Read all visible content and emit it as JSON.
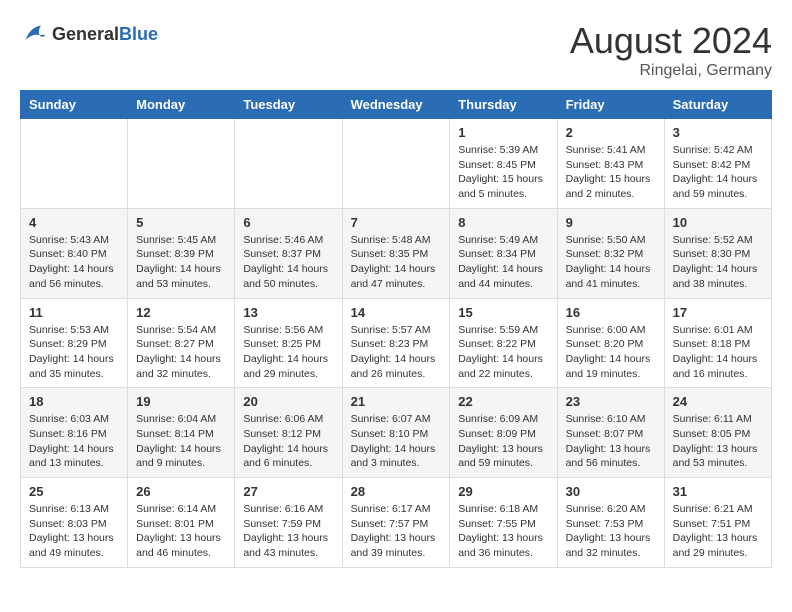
{
  "header": {
    "logo_general": "General",
    "logo_blue": "Blue",
    "month_year": "August 2024",
    "location": "Ringelai, Germany"
  },
  "days_of_week": [
    "Sunday",
    "Monday",
    "Tuesday",
    "Wednesday",
    "Thursday",
    "Friday",
    "Saturday"
  ],
  "weeks": [
    [
      {
        "day": "",
        "info": ""
      },
      {
        "day": "",
        "info": ""
      },
      {
        "day": "",
        "info": ""
      },
      {
        "day": "",
        "info": ""
      },
      {
        "day": "1",
        "info": "Sunrise: 5:39 AM\nSunset: 8:45 PM\nDaylight: 15 hours\nand 5 minutes."
      },
      {
        "day": "2",
        "info": "Sunrise: 5:41 AM\nSunset: 8:43 PM\nDaylight: 15 hours\nand 2 minutes."
      },
      {
        "day": "3",
        "info": "Sunrise: 5:42 AM\nSunset: 8:42 PM\nDaylight: 14 hours\nand 59 minutes."
      }
    ],
    [
      {
        "day": "4",
        "info": "Sunrise: 5:43 AM\nSunset: 8:40 PM\nDaylight: 14 hours\nand 56 minutes."
      },
      {
        "day": "5",
        "info": "Sunrise: 5:45 AM\nSunset: 8:39 PM\nDaylight: 14 hours\nand 53 minutes."
      },
      {
        "day": "6",
        "info": "Sunrise: 5:46 AM\nSunset: 8:37 PM\nDaylight: 14 hours\nand 50 minutes."
      },
      {
        "day": "7",
        "info": "Sunrise: 5:48 AM\nSunset: 8:35 PM\nDaylight: 14 hours\nand 47 minutes."
      },
      {
        "day": "8",
        "info": "Sunrise: 5:49 AM\nSunset: 8:34 PM\nDaylight: 14 hours\nand 44 minutes."
      },
      {
        "day": "9",
        "info": "Sunrise: 5:50 AM\nSunset: 8:32 PM\nDaylight: 14 hours\nand 41 minutes."
      },
      {
        "day": "10",
        "info": "Sunrise: 5:52 AM\nSunset: 8:30 PM\nDaylight: 14 hours\nand 38 minutes."
      }
    ],
    [
      {
        "day": "11",
        "info": "Sunrise: 5:53 AM\nSunset: 8:29 PM\nDaylight: 14 hours\nand 35 minutes."
      },
      {
        "day": "12",
        "info": "Sunrise: 5:54 AM\nSunset: 8:27 PM\nDaylight: 14 hours\nand 32 minutes."
      },
      {
        "day": "13",
        "info": "Sunrise: 5:56 AM\nSunset: 8:25 PM\nDaylight: 14 hours\nand 29 minutes."
      },
      {
        "day": "14",
        "info": "Sunrise: 5:57 AM\nSunset: 8:23 PM\nDaylight: 14 hours\nand 26 minutes."
      },
      {
        "day": "15",
        "info": "Sunrise: 5:59 AM\nSunset: 8:22 PM\nDaylight: 14 hours\nand 22 minutes."
      },
      {
        "day": "16",
        "info": "Sunrise: 6:00 AM\nSunset: 8:20 PM\nDaylight: 14 hours\nand 19 minutes."
      },
      {
        "day": "17",
        "info": "Sunrise: 6:01 AM\nSunset: 8:18 PM\nDaylight: 14 hours\nand 16 minutes."
      }
    ],
    [
      {
        "day": "18",
        "info": "Sunrise: 6:03 AM\nSunset: 8:16 PM\nDaylight: 14 hours\nand 13 minutes."
      },
      {
        "day": "19",
        "info": "Sunrise: 6:04 AM\nSunset: 8:14 PM\nDaylight: 14 hours\nand 9 minutes."
      },
      {
        "day": "20",
        "info": "Sunrise: 6:06 AM\nSunset: 8:12 PM\nDaylight: 14 hours\nand 6 minutes."
      },
      {
        "day": "21",
        "info": "Sunrise: 6:07 AM\nSunset: 8:10 PM\nDaylight: 14 hours\nand 3 minutes."
      },
      {
        "day": "22",
        "info": "Sunrise: 6:09 AM\nSunset: 8:09 PM\nDaylight: 13 hours\nand 59 minutes."
      },
      {
        "day": "23",
        "info": "Sunrise: 6:10 AM\nSunset: 8:07 PM\nDaylight: 13 hours\nand 56 minutes."
      },
      {
        "day": "24",
        "info": "Sunrise: 6:11 AM\nSunset: 8:05 PM\nDaylight: 13 hours\nand 53 minutes."
      }
    ],
    [
      {
        "day": "25",
        "info": "Sunrise: 6:13 AM\nSunset: 8:03 PM\nDaylight: 13 hours\nand 49 minutes."
      },
      {
        "day": "26",
        "info": "Sunrise: 6:14 AM\nSunset: 8:01 PM\nDaylight: 13 hours\nand 46 minutes."
      },
      {
        "day": "27",
        "info": "Sunrise: 6:16 AM\nSunset: 7:59 PM\nDaylight: 13 hours\nand 43 minutes."
      },
      {
        "day": "28",
        "info": "Sunrise: 6:17 AM\nSunset: 7:57 PM\nDaylight: 13 hours\nand 39 minutes."
      },
      {
        "day": "29",
        "info": "Sunrise: 6:18 AM\nSunset: 7:55 PM\nDaylight: 13 hours\nand 36 minutes."
      },
      {
        "day": "30",
        "info": "Sunrise: 6:20 AM\nSunset: 7:53 PM\nDaylight: 13 hours\nand 32 minutes."
      },
      {
        "day": "31",
        "info": "Sunrise: 6:21 AM\nSunset: 7:51 PM\nDaylight: 13 hours\nand 29 minutes."
      }
    ]
  ]
}
